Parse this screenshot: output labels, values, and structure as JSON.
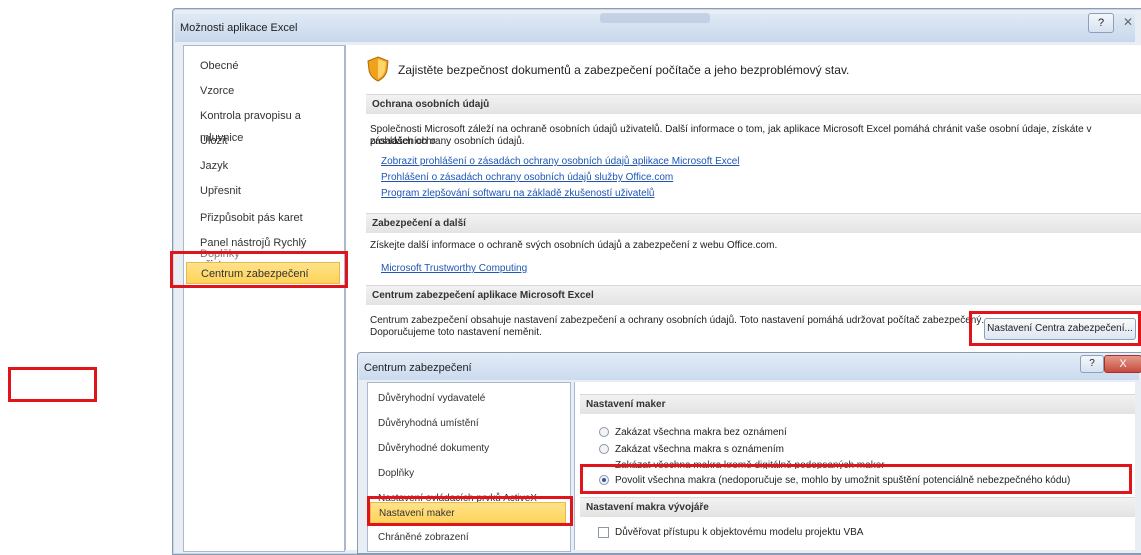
{
  "window": {
    "title": "Možnosti aplikace Excel",
    "help": "?",
    "close": "✕"
  },
  "nav": {
    "items": [
      "Obecné",
      "Vzorce",
      "Kontrola pravopisu a mluvnice",
      "Uložit",
      "Jazyk",
      "Upřesnit",
      "Přizpůsobit pás karet",
      "Panel nástrojů Rychlý přístup",
      "Doplňky",
      "Centrum zabezpečení"
    ],
    "selected": "Centrum zabezpečení"
  },
  "main": {
    "header": "Zajistěte bezpečnost dokumentů a zabezpečení počítače a jeho bezproblémový stav.",
    "privacy": {
      "heading": "Ochrana osobních údajů",
      "text1": "Společnosti Microsoft záleží na ochraně osobních údajů uživatelů. Další informace o tom, jak aplikace Microsoft Excel pomáhá chránit vaše osobní údaje, získáte v prohlášeních o",
      "text2": "zásadách ochrany osobních údajů.",
      "links": [
        "Zobrazit prohlášení o zásadách ochrany osobních údajů aplikace Microsoft Excel",
        "Prohlášení o zásadách ochrany osobních údajů služby Office.com",
        "Program zlepšování softwaru na základě zkušeností uživatelů"
      ]
    },
    "security": {
      "heading": "Zabezpečení a další",
      "text": "Získejte další informace o ochraně svých osobních údajů a zabezpečení z webu Office.com.",
      "link": "Microsoft Trustworthy Computing"
    },
    "trust_center": {
      "heading": "Centrum zabezpečení aplikace Microsoft Excel",
      "text1": "Centrum zabezpečení obsahuje nastavení zabezpečení a ochrany osobních údajů. Toto nastavení pomáhá udržovat počítač zabezpečený.",
      "text2": "Doporučujeme toto nastavení neměnit.",
      "button": "Nastavení Centra zabezpečení..."
    }
  },
  "dialog": {
    "title": "Centrum zabezpečení",
    "help": "?",
    "close": "X",
    "nav": {
      "items": [
        "Důvěryhodní vydavatelé",
        "Důvěryhodná umístění",
        "Důvěryhodné dokumenty",
        "Doplňky",
        "Nastavení ovládacích prvků ActiveX",
        "Nastavení maker",
        "Chráněné zobrazení"
      ],
      "selected": "Nastavení maker"
    },
    "macro_settings": {
      "heading": "Nastavení maker",
      "options": [
        "Zakázat všechna makra bez oznámení",
        "Zakázat všechna makra s oznámením",
        "Zakázat všechna makra kromě digitálně podepsaných maker",
        "Povolit všechna makra (nedoporučuje se, mohlo by umožnit spuštění potenciálně nebezpečného kódu)"
      ],
      "selected_index": 3
    },
    "developer_settings": {
      "heading": "Nastavení makra vývojáře",
      "checkbox": "Důvěřovat přístupu k objektovému modelu projektu VBA"
    }
  },
  "colors": {
    "highlight": "#e0141b",
    "selected": "#ffd35a",
    "link": "#1f56b4"
  }
}
